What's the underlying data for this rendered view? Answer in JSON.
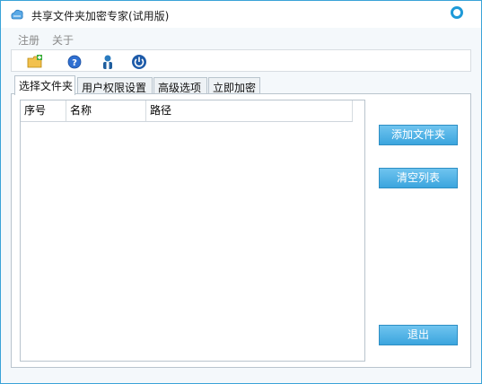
{
  "window": {
    "title": "共享文件夹加密专家(试用版)",
    "accent_color": "#3aa3d8"
  },
  "menu": {
    "items": [
      {
        "label": "注册"
      },
      {
        "label": "关于"
      }
    ]
  },
  "toolbar": {
    "icons": [
      "add-folder-icon",
      "help-icon",
      "user-icon",
      "power-icon"
    ]
  },
  "tabs": [
    {
      "label": "选择文件夹",
      "active": true
    },
    {
      "label": "用户权限设置",
      "active": false
    },
    {
      "label": "高级选项",
      "active": false
    },
    {
      "label": "立即加密",
      "active": false
    }
  ],
  "list": {
    "columns": [
      "序号",
      "名称",
      "路径"
    ],
    "rows": []
  },
  "buttons": {
    "add_folder": "添加文件夹",
    "clear_list": "清空列表",
    "exit": "退出"
  }
}
